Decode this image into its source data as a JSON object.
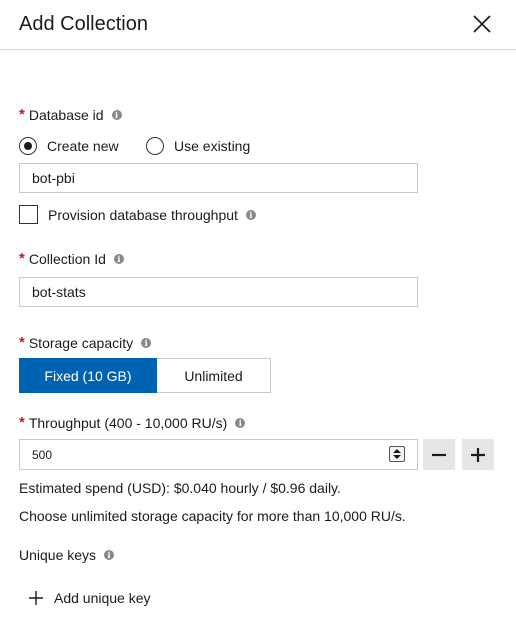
{
  "header": {
    "title": "Add Collection"
  },
  "database": {
    "label": "Database id",
    "radio_create": "Create new",
    "radio_existing": "Use existing",
    "selected": "create",
    "value": "bot-pbi",
    "provision_label": "Provision database throughput",
    "provision_checked": false
  },
  "collection": {
    "label": "Collection Id",
    "value": "bot-stats"
  },
  "storage": {
    "label": "Storage capacity",
    "options": [
      "Fixed (10 GB)",
      "Unlimited"
    ],
    "selected": "Fixed (10 GB)"
  },
  "throughput": {
    "label": "Throughput (400 - 10,000 RU/s)",
    "value": "500",
    "estimate": "Estimated spend (USD): $0.040 hourly / $0.96 daily.",
    "hint": "Choose unlimited storage capacity for more than 10,000 RU/s."
  },
  "unique_keys": {
    "label": "Unique keys",
    "add_label": "Add unique key"
  },
  "colors": {
    "accent": "#0063b1",
    "required": "#e00b1c",
    "info": "#8a8886"
  }
}
